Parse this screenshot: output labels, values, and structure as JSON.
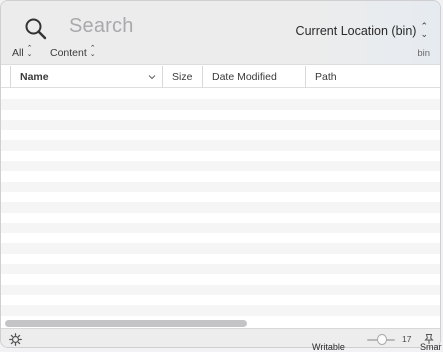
{
  "search": {
    "placeholder": "Search"
  },
  "location": {
    "label": "Current Location (bin)"
  },
  "filters": {
    "kind": "All",
    "scope": "Content"
  },
  "scope_label": "bin",
  "columns": [
    {
      "label": "Name"
    },
    {
      "label": "Size"
    },
    {
      "label": "Date Modified"
    },
    {
      "label": "Path"
    }
  ],
  "footer": {
    "zoom_value": "17"
  },
  "background_text": {
    "left": "Writable",
    "right": "Smar"
  },
  "icons": {
    "search": "search-icon",
    "gear": "gear-icon",
    "pin": "pin-icon",
    "sort": "chevron-down-icon",
    "updown": "updown-chevron-icon"
  },
  "colors": {
    "header_bg": "#ececec",
    "stripe": "#f5f5f5",
    "text": "#3a3a3a",
    "placeholder": "#a9a9ad"
  }
}
